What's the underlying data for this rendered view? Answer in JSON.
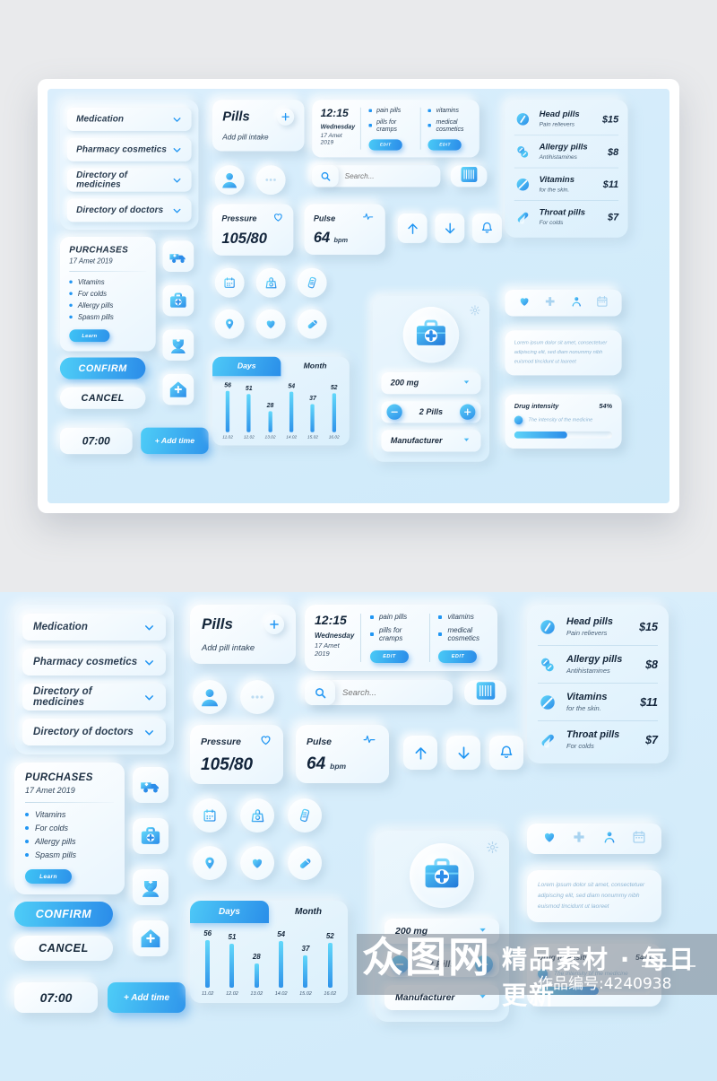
{
  "dropdowns": [
    {
      "label": "Medication"
    },
    {
      "label": "Pharmacy cosmetics"
    },
    {
      "label": "Directory of medicines"
    },
    {
      "label": "Directory of doctors"
    }
  ],
  "purchases": {
    "title": "PURCHASES",
    "date": "17 Amet 2019",
    "items": [
      "Vitamins",
      "For colds",
      "Allergy pills",
      "Spasm pills"
    ],
    "learn_label": "Learn"
  },
  "actions": {
    "confirm": "CONFIRM",
    "cancel": "CANCEL",
    "time_value": "07:00",
    "add_time": "+ Add time"
  },
  "side_icons": [
    "ambulance-icon",
    "first-aid-kit-icon",
    "nurse-icon",
    "home-hospital-icon"
  ],
  "pills_card": {
    "title": "Pills",
    "subtitle": "Add pill intake",
    "add_icon": "plus-icon"
  },
  "avatar_row": {
    "avatar_icon": "user-avatar-icon",
    "more_icon": "ellipsis-icon"
  },
  "time_card": {
    "time": "12:15",
    "weekday": "Wednesday",
    "date": "17 Amet 2019"
  },
  "tag_groups": [
    {
      "tags": [
        "pain pills",
        "pills for cramps"
      ],
      "edit_label": "EDIT"
    },
    {
      "tags": [
        "vitamins",
        "medical cosmetics"
      ],
      "edit_label": "EDIT"
    }
  ],
  "search": {
    "placeholder": "Search...",
    "icon": "search-icon"
  },
  "barcode_icon": "barcode-icon",
  "metrics": [
    {
      "label": "Pressure",
      "value": "105/80",
      "unit": "",
      "icon": "heart-outline-icon"
    },
    {
      "label": "Pulse",
      "value": "64",
      "unit": "bpm",
      "icon": "pulse-wave-icon"
    }
  ],
  "arrow_buttons": [
    "arrow-up-icon",
    "arrow-down-icon",
    "bell-icon"
  ],
  "round_icons": [
    "calendar-icon",
    "scale-icon",
    "thermometer-strip-icon",
    "location-pin-icon",
    "heart-icon",
    "capsule-icon"
  ],
  "dosage": {
    "gear_icon": "gear-icon",
    "kit_icon": "medical-kit-icon",
    "dose_value": "200 mg",
    "count_value": "2 Pills",
    "manufacturer_value": "Manufacturer",
    "minus_icon": "minus-icon",
    "plus_icon": "plus-icon"
  },
  "price_list": [
    {
      "icon": "head-pill-icon",
      "name": "Head pills",
      "desc": "Pain relievers",
      "price": "$15"
    },
    {
      "icon": "allergy-pill-icon",
      "name": "Allergy pills",
      "desc": "Antihistamines",
      "price": "$8"
    },
    {
      "icon": "vitamin-pill-icon",
      "name": "Vitamins",
      "desc": "for the skin.",
      "price": "$11"
    },
    {
      "icon": "throat-pill-icon",
      "name": "Throat pills",
      "desc": "For colds",
      "price": "$7"
    }
  ],
  "icon_strip": [
    "heart-icon",
    "plus-cross-icon",
    "person-icon",
    "calendar-icon"
  ],
  "lorem": "Lorem ipsum dolor sit amet, consectetuer adipiscing elit, sed diam nonummy nibh euismod tincidunt ut laoreet",
  "intensity": {
    "title": "Drug intensity",
    "percent_label": "54%",
    "percent_value": 54,
    "subtitle": "The intensity of the medicine"
  },
  "chart_data": {
    "type": "bar",
    "title": "",
    "tabs": [
      "Days",
      "Month"
    ],
    "active_tab": "Days",
    "categories": [
      "11.02",
      "12.02",
      "13.02",
      "14.02",
      "15.02",
      "16.02"
    ],
    "values": [
      56,
      51,
      28,
      54,
      37,
      52
    ],
    "xlabel": "",
    "ylabel": "",
    "ylim": [
      0,
      60
    ],
    "grid": false,
    "legend": "none"
  },
  "colors": {
    "accent": "#2b8ce9",
    "accent_light": "#5ed3f8",
    "text_dark": "#14263a",
    "bg": "#d6edfb"
  },
  "watermark": {
    "logo": "众图网",
    "tagline": "精品素材 · 每日更新",
    "code": "作品编号:4240938"
  }
}
